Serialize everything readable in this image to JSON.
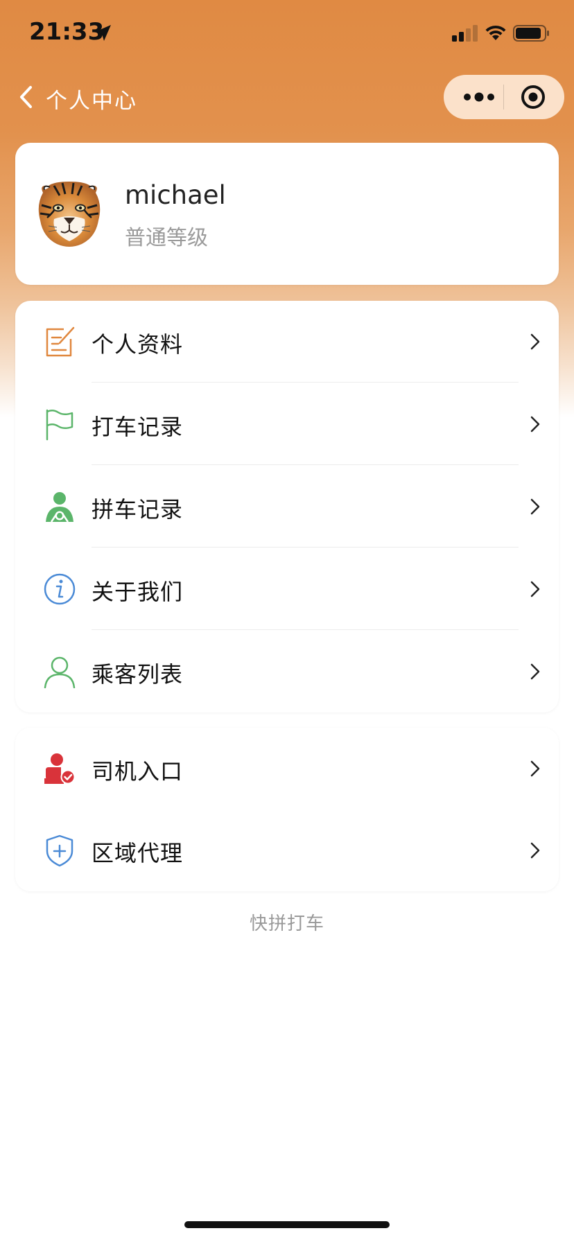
{
  "status_bar": {
    "time": "21:33",
    "location_icon": "location-arrow-icon",
    "signal_icon": "signal-icon",
    "wifi_icon": "wifi-icon",
    "battery_icon": "battery-icon"
  },
  "nav": {
    "back_icon": "chevron-left-icon",
    "title": "个人中心",
    "more_icon": "more-dots-icon",
    "close_icon": "target-close-icon"
  },
  "profile": {
    "avatar": "tiger-avatar",
    "name": "michael",
    "level": "普通等级"
  },
  "menu_group_1": [
    {
      "label": "个人资料",
      "icon": "edit-note-icon",
      "color": "#e0873e"
    },
    {
      "label": "打车记录",
      "icon": "flag-icon",
      "color": "#5bb56a"
    },
    {
      "label": "拼车记录",
      "icon": "carpool-user-icon",
      "color": "#5bb56a"
    },
    {
      "label": "关于我们",
      "icon": "info-circle-icon",
      "color": "#4a8ad6"
    },
    {
      "label": "乘客列表",
      "icon": "user-outline-icon",
      "color": "#5bb56a"
    }
  ],
  "menu_group_2": [
    {
      "label": "司机入口",
      "icon": "driver-verified-icon",
      "color": "#d9333a"
    },
    {
      "label": "区域代理",
      "icon": "shield-plus-icon",
      "color": "#4a8ad6"
    }
  ],
  "footer": {
    "text": "快拼打车"
  },
  "colors": {
    "header_orange": "#e08a43",
    "card_bg": "#ffffff",
    "text_primary": "#111111",
    "text_secondary": "#9a9a9a"
  }
}
